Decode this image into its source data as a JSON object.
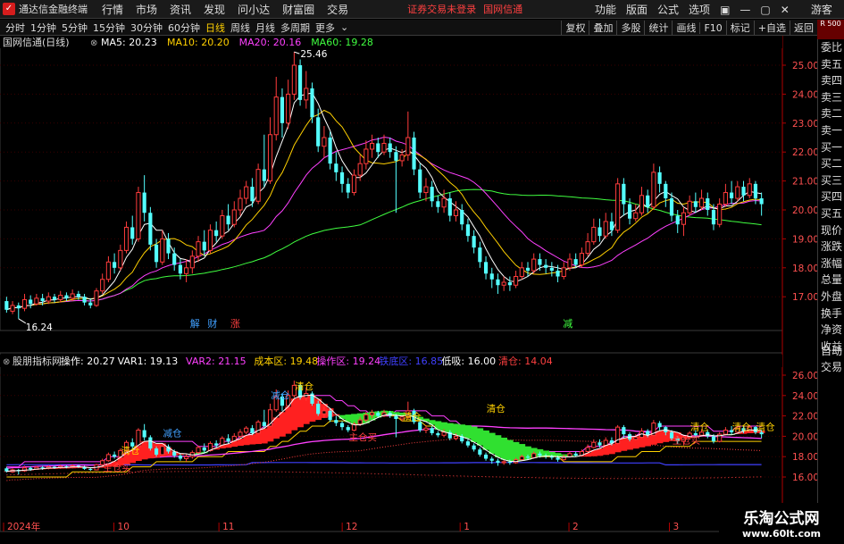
{
  "app": {
    "title": "通达信金融终端",
    "menu": [
      "行情",
      "市场",
      "资讯",
      "发现",
      "问小达",
      "财富圈",
      "交易"
    ],
    "status": "证券交易未登录",
    "stock_name": "国网信通",
    "right_menu": [
      "功能",
      "版面",
      "公式",
      "选项"
    ],
    "guest": "游客",
    "window_controls": [
      "▣",
      "—",
      "▢",
      "✕"
    ]
  },
  "periods": [
    "分时",
    "1分钟",
    "5分钟",
    "15分钟",
    "30分钟",
    "60分钟",
    "日线",
    "周线",
    "月线",
    "多周期",
    "更多"
  ],
  "active_period": "日线",
  "right_tools": [
    "复权",
    "叠加",
    "多股",
    "统计",
    "画线",
    "F10",
    "标记",
    "+自选",
    "返回"
  ],
  "red_note": "R 500",
  "side_panel": [
    "委比",
    "卖五",
    "卖四",
    "卖三",
    "卖二",
    "卖一",
    "买一",
    "买二",
    "买三",
    "买四",
    "买五",
    "现价",
    "涨跌",
    "涨幅",
    "总量",
    "外盘",
    "换手",
    "净资",
    "收益"
  ],
  "side_panel_lower": [
    "自动",
    "交易"
  ],
  "main_panel": {
    "title": "国网信通(日线)",
    "ma": [
      {
        "label": "MA5: 20.23",
        "color": "#ffffff"
      },
      {
        "label": "MA10: 20.20",
        "color": "#ffd000"
      },
      {
        "label": "MA20: 20.16",
        "color": "#ff40ff"
      },
      {
        "label": "MA60: 19.28",
        "color": "#40ff40"
      }
    ],
    "high_label": "25.46",
    "low_label": "16.24",
    "marks": [
      {
        "text": "解",
        "color": "#40a0ff"
      },
      {
        "text": "财",
        "color": "#40a0ff"
      },
      {
        "text": "涨",
        "color": "#ff4040"
      },
      {
        "text": "减",
        "color": "#40ff40"
      }
    ],
    "y_ticks": [
      "25.00",
      "24.00",
      "23.00",
      "22.00",
      "21.00",
      "20.00",
      "19.00",
      "18.00",
      "17.00"
    ]
  },
  "indicator_panel": {
    "title": "股朋指标网",
    "values": [
      {
        "label": "操作: 20.27",
        "color": "#ffffff"
      },
      {
        "label": "VAR1: 19.13",
        "color": "#ffffff"
      },
      {
        "label": "VAR2: 21.15",
        "color": "#ff40ff"
      },
      {
        "label": "成本区: 19.48",
        "color": "#ffd000"
      },
      {
        "label": "操作区: 19.24",
        "color": "#ff40ff"
      },
      {
        "label": "铁底区: 16.85",
        "color": "#4040ff"
      },
      {
        "label": "低吸: 16.00",
        "color": "#ffffff"
      },
      {
        "label": "清仓: 14.04",
        "color": "#ff4040"
      }
    ],
    "y_ticks": [
      "26.00",
      "24.00",
      "22.00",
      "20.00",
      "18.00",
      "16.00"
    ],
    "annotations": [
      {
        "text": "清仓",
        "color": "#ffd000"
      },
      {
        "text": "减仓",
        "color": "#40a0ff"
      },
      {
        "text": "清仓",
        "color": "#ffd000"
      },
      {
        "text": "主仓买",
        "color": "#ff4040"
      },
      {
        "text": "清仓",
        "color": "#ffd000"
      },
      {
        "text": "清仓",
        "color": "#ffd000"
      },
      {
        "text": "清仓",
        "color": "#ffd000"
      },
      {
        "text": "清仓",
        "color": "#ffd000"
      },
      {
        "text": "清仓",
        "color": "#ffd000"
      },
      {
        "text": "主仓买",
        "color": "#ff4040"
      },
      {
        "text": "主仓买",
        "color": "#ff4040"
      },
      {
        "text": "减仓",
        "color": "#40a0ff"
      }
    ]
  },
  "x_axis": [
    "2024年",
    "10",
    "11",
    "12",
    "1",
    "2",
    "3"
  ],
  "watermark": {
    "line1": "乐淘公式网",
    "line2": "www.60lt.com"
  },
  "chart_data": {
    "type": "candlestick",
    "title": "国网信通(日线)",
    "y_range": [
      16.0,
      25.6
    ],
    "x_labels": [
      "2024年",
      "10",
      "11",
      "12",
      "1",
      "2",
      "3"
    ],
    "high": 25.46,
    "low": 16.24,
    "candles": [
      {
        "o": 16.85,
        "c": 16.55,
        "h": 17.0,
        "l": 16.45
      },
      {
        "o": 16.5,
        "c": 16.7,
        "h": 16.85,
        "l": 16.4
      },
      {
        "o": 16.7,
        "c": 16.6,
        "h": 16.8,
        "l": 16.24
      },
      {
        "o": 16.6,
        "c": 16.9,
        "h": 17.1,
        "l": 16.5
      },
      {
        "o": 16.9,
        "c": 16.75,
        "h": 17.05,
        "l": 16.6
      },
      {
        "o": 16.75,
        "c": 16.95,
        "h": 17.1,
        "l": 16.7
      },
      {
        "o": 16.95,
        "c": 16.85,
        "h": 17.1,
        "l": 16.7
      },
      {
        "o": 16.85,
        "c": 17.0,
        "h": 17.15,
        "l": 16.75
      },
      {
        "o": 17.0,
        "c": 16.9,
        "h": 17.1,
        "l": 16.8
      },
      {
        "o": 16.9,
        "c": 17.05,
        "h": 17.2,
        "l": 16.8
      },
      {
        "o": 17.05,
        "c": 16.95,
        "h": 17.15,
        "l": 16.85
      },
      {
        "o": 16.95,
        "c": 17.1,
        "h": 17.25,
        "l": 16.85
      },
      {
        "o": 17.1,
        "c": 17.0,
        "h": 17.2,
        "l": 16.9
      },
      {
        "o": 17.0,
        "c": 16.8,
        "h": 17.1,
        "l": 16.7
      },
      {
        "o": 16.8,
        "c": 16.7,
        "h": 16.95,
        "l": 16.6
      },
      {
        "o": 16.7,
        "c": 17.2,
        "h": 17.3,
        "l": 16.65
      },
      {
        "o": 17.2,
        "c": 17.6,
        "h": 17.8,
        "l": 17.1
      },
      {
        "o": 17.6,
        "c": 18.2,
        "h": 18.4,
        "l": 17.5
      },
      {
        "o": 18.2,
        "c": 18.0,
        "h": 18.5,
        "l": 17.8
      },
      {
        "o": 18.0,
        "c": 18.6,
        "h": 18.8,
        "l": 17.9
      },
      {
        "o": 18.6,
        "c": 19.4,
        "h": 19.6,
        "l": 18.5
      },
      {
        "o": 19.4,
        "c": 19.0,
        "h": 19.8,
        "l": 18.8
      },
      {
        "o": 19.0,
        "c": 20.6,
        "h": 20.8,
        "l": 18.9
      },
      {
        "o": 20.6,
        "c": 19.9,
        "h": 21.2,
        "l": 19.6
      },
      {
        "o": 19.9,
        "c": 18.8,
        "h": 20.1,
        "l": 18.6
      },
      {
        "o": 18.8,
        "c": 18.2,
        "h": 19.0,
        "l": 18.0
      },
      {
        "o": 18.2,
        "c": 19.0,
        "h": 19.3,
        "l": 18.1
      },
      {
        "o": 19.0,
        "c": 18.5,
        "h": 19.2,
        "l": 18.3
      },
      {
        "o": 18.5,
        "c": 18.1,
        "h": 18.7,
        "l": 17.9
      },
      {
        "o": 18.1,
        "c": 17.8,
        "h": 18.3,
        "l": 17.6
      },
      {
        "o": 17.8,
        "c": 18.0,
        "h": 18.3,
        "l": 17.5
      },
      {
        "o": 18.0,
        "c": 18.4,
        "h": 18.6,
        "l": 17.8
      },
      {
        "o": 18.4,
        "c": 18.9,
        "h": 19.1,
        "l": 18.2
      },
      {
        "o": 18.9,
        "c": 18.6,
        "h": 19.3,
        "l": 18.4
      },
      {
        "o": 18.6,
        "c": 19.3,
        "h": 19.5,
        "l": 18.5
      },
      {
        "o": 19.3,
        "c": 19.1,
        "h": 19.6,
        "l": 18.9
      },
      {
        "o": 19.1,
        "c": 19.8,
        "h": 20.0,
        "l": 19.0
      },
      {
        "o": 19.8,
        "c": 19.5,
        "h": 20.2,
        "l": 19.3
      },
      {
        "o": 19.5,
        "c": 20.0,
        "h": 20.3,
        "l": 19.4
      },
      {
        "o": 20.0,
        "c": 20.4,
        "h": 20.7,
        "l": 19.8
      },
      {
        "o": 20.4,
        "c": 20.8,
        "h": 21.0,
        "l": 20.2
      },
      {
        "o": 20.8,
        "c": 20.3,
        "h": 21.1,
        "l": 20.1
      },
      {
        "o": 20.3,
        "c": 21.4,
        "h": 21.6,
        "l": 20.2
      },
      {
        "o": 21.4,
        "c": 21.0,
        "h": 22.6,
        "l": 20.8
      },
      {
        "o": 21.0,
        "c": 22.6,
        "h": 23.2,
        "l": 20.9
      },
      {
        "o": 22.6,
        "c": 23.9,
        "h": 24.6,
        "l": 22.4
      },
      {
        "o": 23.9,
        "c": 23.0,
        "h": 24.2,
        "l": 22.5
      },
      {
        "o": 23.0,
        "c": 24.0,
        "h": 24.5,
        "l": 22.8
      },
      {
        "o": 24.0,
        "c": 25.0,
        "h": 25.46,
        "l": 23.8
      },
      {
        "o": 25.0,
        "c": 23.8,
        "h": 25.2,
        "l": 23.6
      },
      {
        "o": 23.8,
        "c": 24.2,
        "h": 24.8,
        "l": 23.5
      },
      {
        "o": 24.2,
        "c": 23.2,
        "h": 24.4,
        "l": 23.0
      },
      {
        "o": 23.2,
        "c": 22.2,
        "h": 23.5,
        "l": 22.0
      },
      {
        "o": 22.2,
        "c": 22.5,
        "h": 22.9,
        "l": 21.8
      },
      {
        "o": 22.5,
        "c": 21.6,
        "h": 22.7,
        "l": 21.4
      },
      {
        "o": 21.6,
        "c": 21.3,
        "h": 22.0,
        "l": 21.0
      },
      {
        "o": 21.3,
        "c": 20.9,
        "h": 21.5,
        "l": 20.6
      },
      {
        "o": 20.9,
        "c": 20.6,
        "h": 21.1,
        "l": 20.4
      },
      {
        "o": 20.6,
        "c": 21.2,
        "h": 21.4,
        "l": 20.5
      },
      {
        "o": 21.2,
        "c": 21.6,
        "h": 21.9,
        "l": 21.0
      },
      {
        "o": 21.6,
        "c": 22.1,
        "h": 22.4,
        "l": 21.4
      },
      {
        "o": 22.1,
        "c": 22.3,
        "h": 22.6,
        "l": 21.8
      },
      {
        "o": 22.3,
        "c": 22.0,
        "h": 22.5,
        "l": 21.8
      },
      {
        "o": 22.0,
        "c": 22.3,
        "h": 22.6,
        "l": 21.9
      },
      {
        "o": 22.3,
        "c": 22.0,
        "h": 22.5,
        "l": 21.8
      },
      {
        "o": 22.0,
        "c": 21.7,
        "h": 22.2,
        "l": 19.9
      },
      {
        "o": 21.7,
        "c": 21.9,
        "h": 22.1,
        "l": 21.5
      },
      {
        "o": 21.9,
        "c": 22.5,
        "h": 23.4,
        "l": 21.7
      },
      {
        "o": 22.5,
        "c": 21.4,
        "h": 22.7,
        "l": 21.2
      },
      {
        "o": 21.4,
        "c": 20.6,
        "h": 21.6,
        "l": 20.4
      },
      {
        "o": 20.6,
        "c": 20.8,
        "h": 21.1,
        "l": 20.3
      },
      {
        "o": 20.8,
        "c": 20.3,
        "h": 21.0,
        "l": 20.1
      },
      {
        "o": 20.3,
        "c": 20.1,
        "h": 20.5,
        "l": 19.9
      },
      {
        "o": 20.1,
        "c": 20.4,
        "h": 20.7,
        "l": 19.9
      },
      {
        "o": 20.4,
        "c": 19.8,
        "h": 20.6,
        "l": 19.6
      },
      {
        "o": 19.8,
        "c": 20.0,
        "h": 20.3,
        "l": 19.6
      },
      {
        "o": 20.0,
        "c": 19.5,
        "h": 20.2,
        "l": 19.3
      },
      {
        "o": 19.5,
        "c": 19.1,
        "h": 19.7,
        "l": 18.9
      },
      {
        "o": 19.1,
        "c": 18.7,
        "h": 19.3,
        "l": 18.5
      },
      {
        "o": 18.7,
        "c": 18.2,
        "h": 18.9,
        "l": 18.0
      },
      {
        "o": 18.2,
        "c": 17.8,
        "h": 18.4,
        "l": 17.6
      },
      {
        "o": 17.8,
        "c": 17.6,
        "h": 18.0,
        "l": 17.3
      },
      {
        "o": 17.6,
        "c": 17.4,
        "h": 17.8,
        "l": 17.1
      },
      {
        "o": 17.4,
        "c": 17.5,
        "h": 17.7,
        "l": 17.2
      },
      {
        "o": 17.5,
        "c": 17.4,
        "h": 17.7,
        "l": 17.2
      },
      {
        "o": 17.4,
        "c": 17.7,
        "h": 17.9,
        "l": 17.3
      },
      {
        "o": 17.7,
        "c": 18.0,
        "h": 18.2,
        "l": 17.6
      },
      {
        "o": 18.0,
        "c": 17.9,
        "h": 18.2,
        "l": 17.7
      },
      {
        "o": 17.9,
        "c": 18.3,
        "h": 18.5,
        "l": 17.8
      },
      {
        "o": 18.3,
        "c": 18.1,
        "h": 18.5,
        "l": 17.9
      },
      {
        "o": 18.1,
        "c": 18.0,
        "h": 18.3,
        "l": 17.8
      },
      {
        "o": 18.0,
        "c": 17.9,
        "h": 18.2,
        "l": 17.7
      },
      {
        "o": 17.9,
        "c": 17.7,
        "h": 18.1,
        "l": 17.5
      },
      {
        "o": 17.7,
        "c": 18.0,
        "h": 18.2,
        "l": 17.6
      },
      {
        "o": 18.0,
        "c": 18.3,
        "h": 18.5,
        "l": 17.9
      },
      {
        "o": 18.3,
        "c": 18.1,
        "h": 18.5,
        "l": 18.0
      },
      {
        "o": 18.1,
        "c": 18.5,
        "h": 18.7,
        "l": 18.0
      },
      {
        "o": 18.5,
        "c": 18.9,
        "h": 19.2,
        "l": 18.4
      },
      {
        "o": 18.9,
        "c": 19.4,
        "h": 19.7,
        "l": 18.8
      },
      {
        "o": 19.4,
        "c": 19.1,
        "h": 19.7,
        "l": 18.9
      },
      {
        "o": 19.1,
        "c": 19.6,
        "h": 19.9,
        "l": 19.0
      },
      {
        "o": 19.6,
        "c": 19.3,
        "h": 19.9,
        "l": 19.1
      },
      {
        "o": 19.3,
        "c": 20.9,
        "h": 21.1,
        "l": 19.2
      },
      {
        "o": 20.9,
        "c": 20.2,
        "h": 21.1,
        "l": 19.8
      },
      {
        "o": 20.2,
        "c": 19.7,
        "h": 20.4,
        "l": 19.5
      },
      {
        "o": 19.7,
        "c": 19.9,
        "h": 20.2,
        "l": 19.6
      },
      {
        "o": 19.9,
        "c": 20.5,
        "h": 20.8,
        "l": 19.8
      },
      {
        "o": 20.5,
        "c": 20.1,
        "h": 20.7,
        "l": 19.9
      },
      {
        "o": 20.1,
        "c": 21.3,
        "h": 21.6,
        "l": 20.0
      },
      {
        "o": 21.3,
        "c": 20.9,
        "h": 21.5,
        "l": 20.6
      },
      {
        "o": 20.9,
        "c": 20.4,
        "h": 21.0,
        "l": 20.1
      },
      {
        "o": 20.4,
        "c": 19.8,
        "h": 20.6,
        "l": 19.6
      },
      {
        "o": 19.8,
        "c": 19.5,
        "h": 20.0,
        "l": 19.2
      },
      {
        "o": 19.5,
        "c": 19.9,
        "h": 20.1,
        "l": 19.1
      },
      {
        "o": 19.9,
        "c": 20.3,
        "h": 20.5,
        "l": 19.8
      },
      {
        "o": 20.3,
        "c": 20.1,
        "h": 20.6,
        "l": 19.9
      },
      {
        "o": 20.1,
        "c": 20.4,
        "h": 20.7,
        "l": 20.0
      },
      {
        "o": 20.4,
        "c": 20.0,
        "h": 20.6,
        "l": 19.8
      },
      {
        "o": 20.0,
        "c": 19.5,
        "h": 20.2,
        "l": 19.3
      },
      {
        "o": 19.5,
        "c": 20.2,
        "h": 20.4,
        "l": 19.4
      },
      {
        "o": 20.2,
        "c": 20.6,
        "h": 20.9,
        "l": 20.1
      },
      {
        "o": 20.6,
        "c": 20.4,
        "h": 21.0,
        "l": 20.2
      },
      {
        "o": 20.4,
        "c": 20.8,
        "h": 21.0,
        "l": 20.3
      },
      {
        "o": 20.8,
        "c": 20.5,
        "h": 21.0,
        "l": 20.3
      },
      {
        "o": 20.5,
        "c": 20.9,
        "h": 21.1,
        "l": 20.4
      },
      {
        "o": 20.9,
        "c": 20.4,
        "h": 21.0,
        "l": 20.2
      },
      {
        "o": 20.4,
        "c": 20.2,
        "h": 20.6,
        "l": 19.8
      }
    ]
  }
}
